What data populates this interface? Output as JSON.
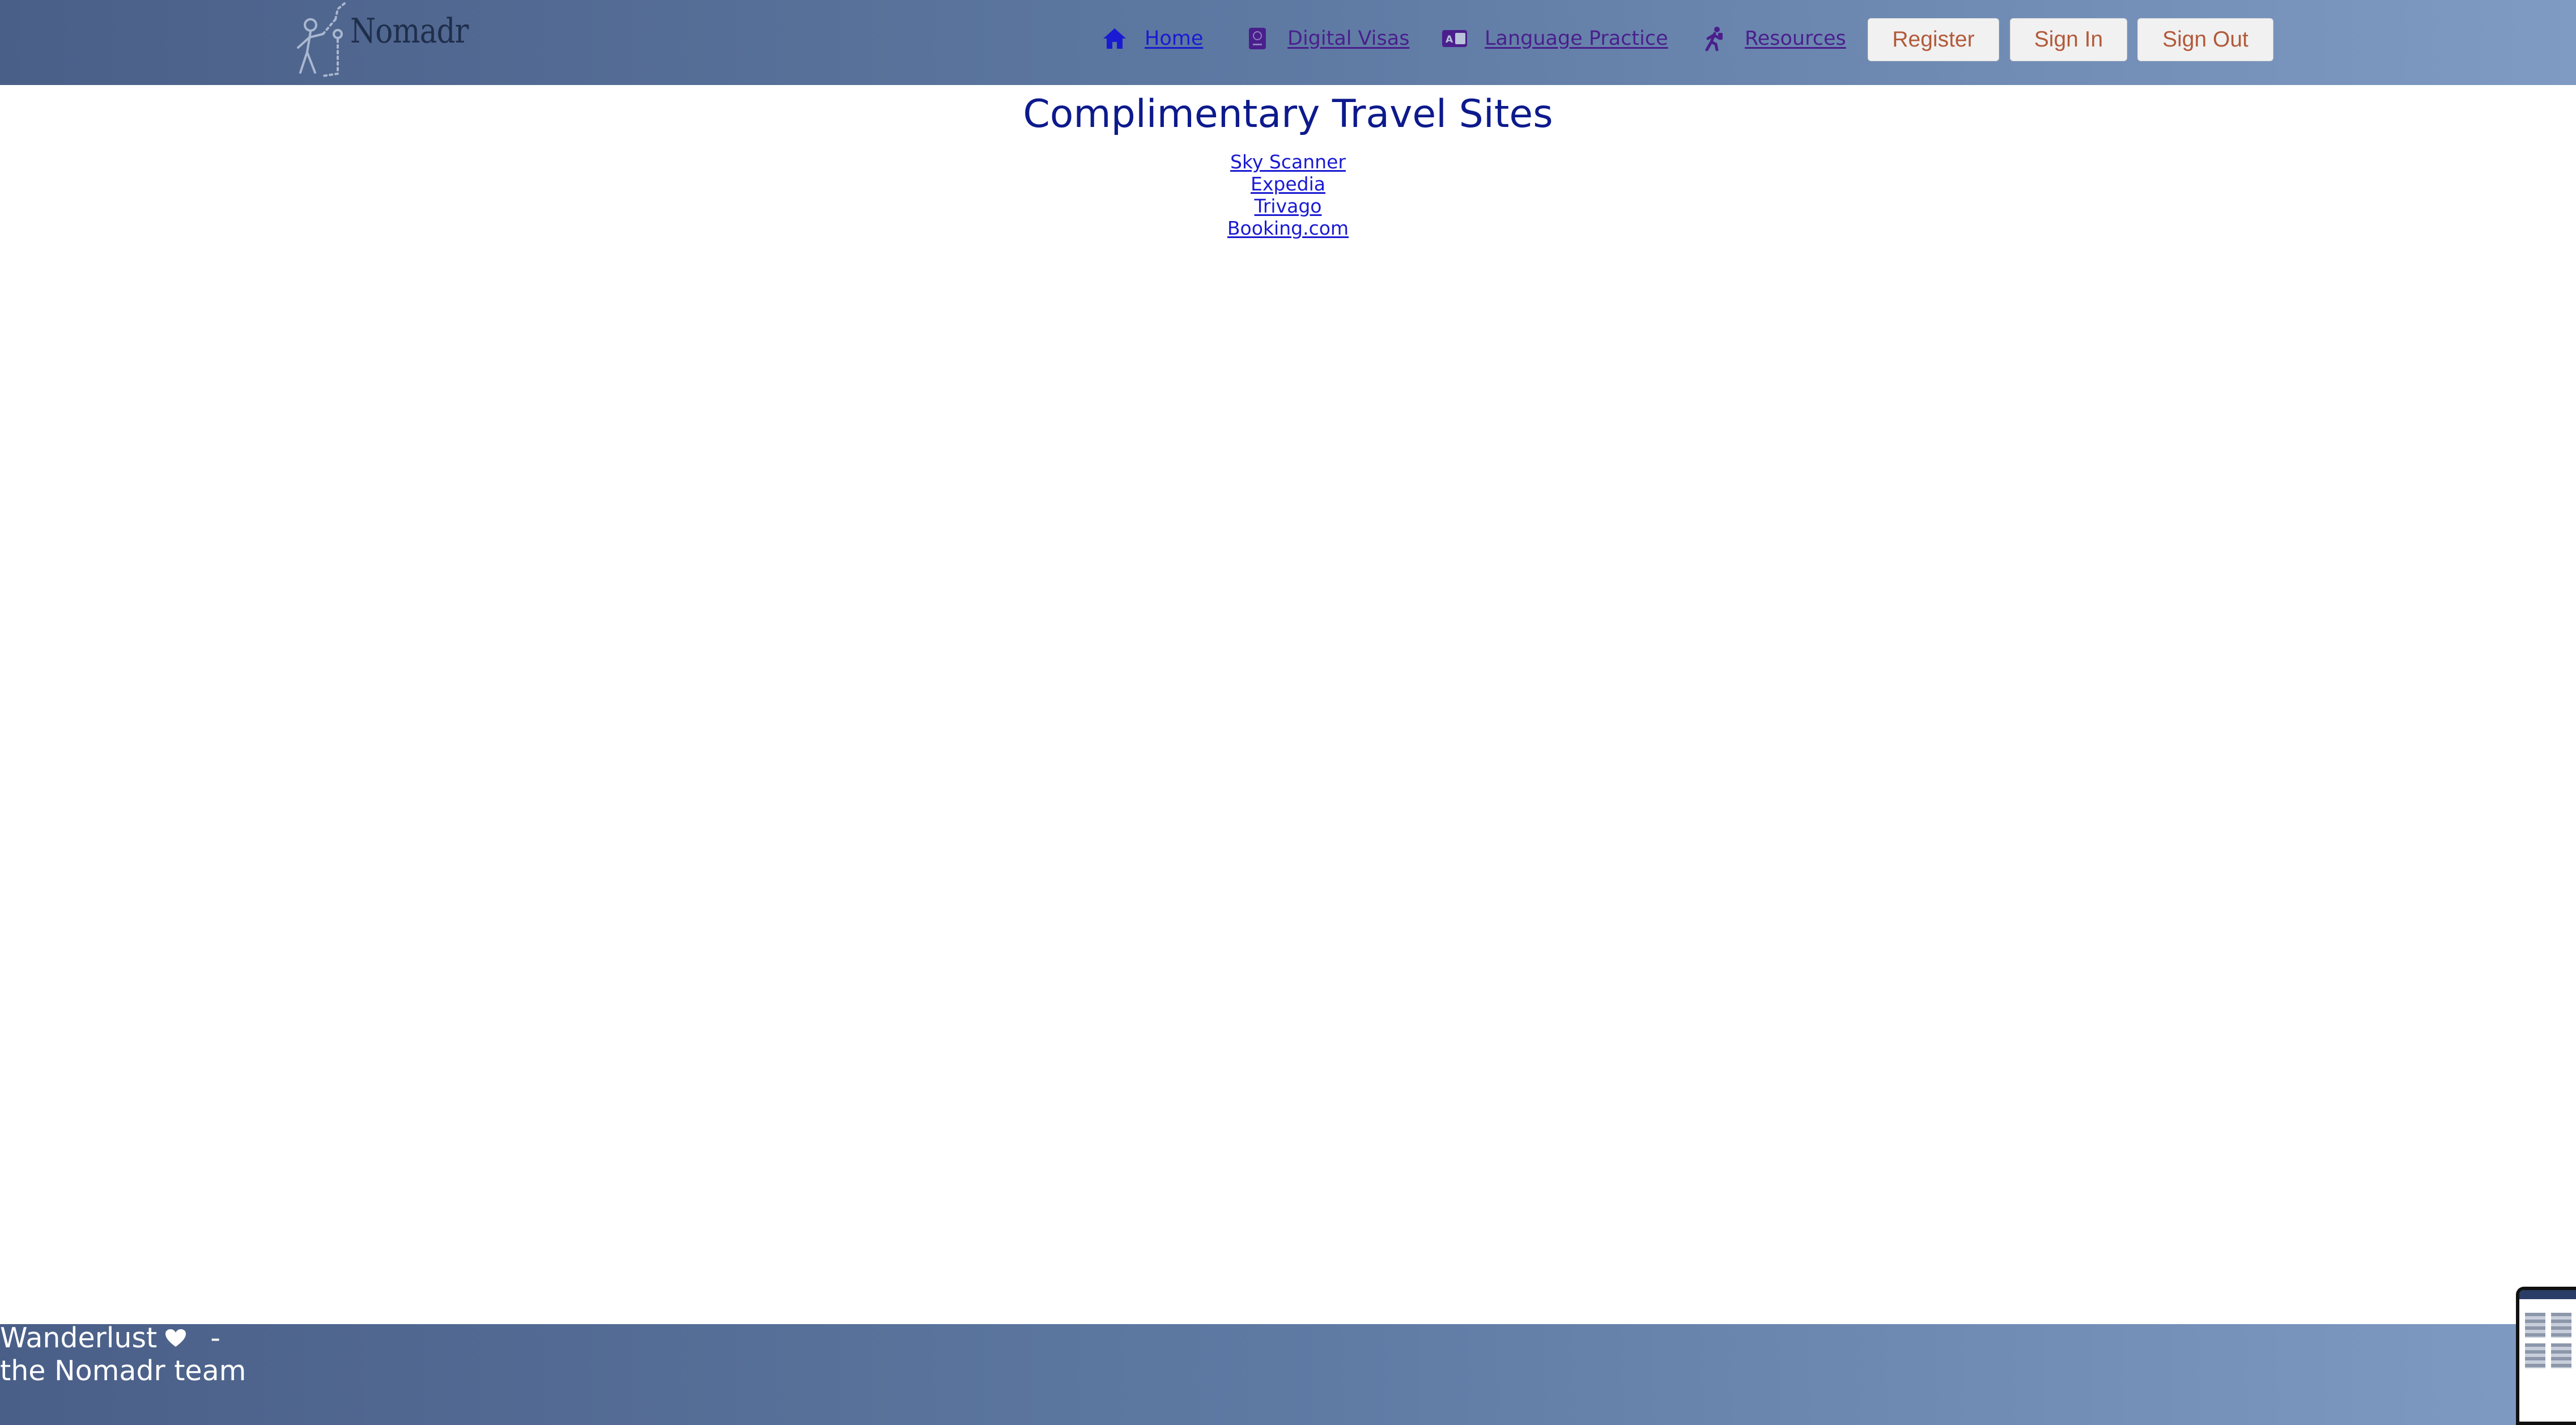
{
  "header": {
    "logo_text": "Nomadr",
    "nav": [
      {
        "label": "Home",
        "icon": "home-icon"
      },
      {
        "label": "Digital Visas",
        "icon": "passport-icon"
      },
      {
        "label": "Language Practice",
        "icon": "language-icon"
      },
      {
        "label": "Resources",
        "icon": "hiker-icon"
      }
    ],
    "buttons": {
      "register": "Register",
      "sign_in": "Sign In",
      "sign_out": "Sign Out"
    }
  },
  "main": {
    "title": "Complimentary Travel Sites",
    "sites": [
      {
        "label": "Sky Scanner"
      },
      {
        "label": "Expedia"
      },
      {
        "label": "Trivago"
      },
      {
        "label": "Booking.com"
      }
    ]
  },
  "footer": {
    "line1": "Wanderlust",
    "separator": "-",
    "line2": "the Nomadr team"
  },
  "colors": {
    "header_gradient_start": "#4a5f88",
    "header_gradient_end": "#7f9bc3",
    "title": "#0d1a8c",
    "link": "#1a1ad2",
    "visited_link": "#4a1f8c",
    "button_text": "#b25a3a"
  }
}
